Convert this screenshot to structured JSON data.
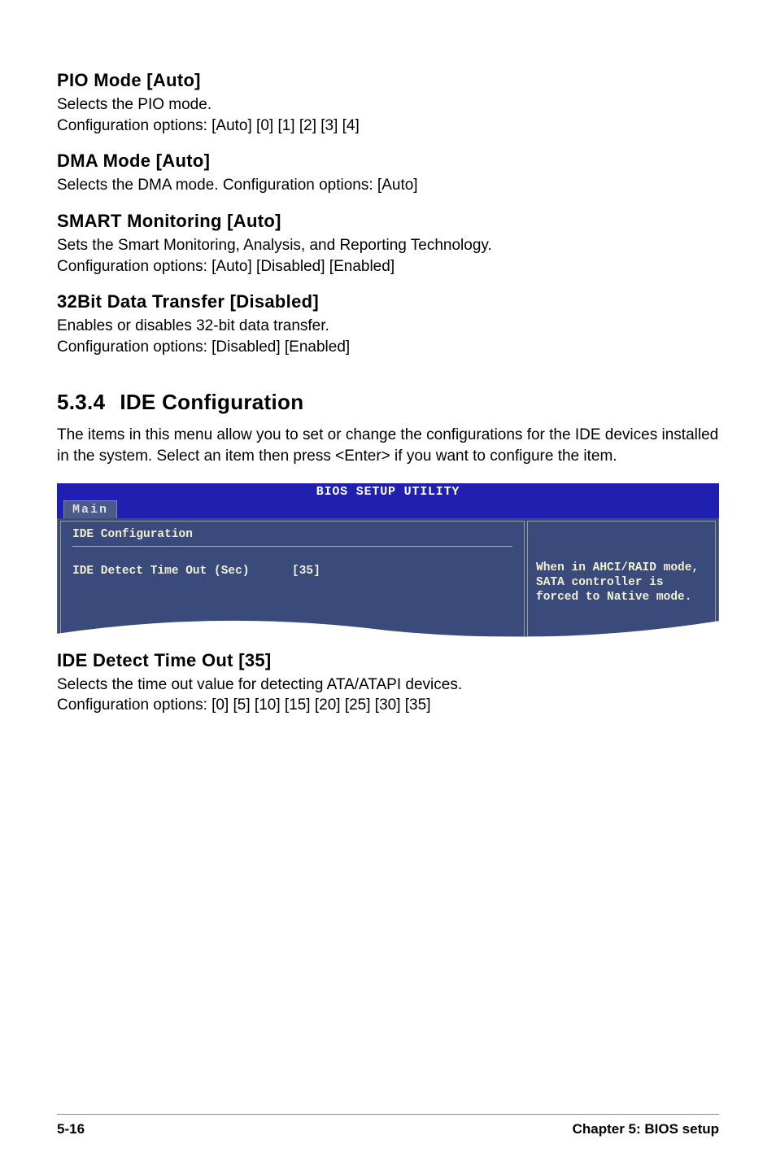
{
  "items": {
    "pio": {
      "heading": "PIO Mode [Auto]",
      "body": "Selects the PIO mode.\nConfiguration options: [Auto] [0] [1] [2] [3] [4]"
    },
    "dma": {
      "heading": "DMA Mode [Auto]",
      "body": "Selects the DMA mode. Configuration options: [Auto]"
    },
    "smart": {
      "heading": "SMART Monitoring [Auto]",
      "body": "Sets the Smart Monitoring, Analysis, and Reporting Technology.\nConfiguration options: [Auto] [Disabled] [Enabled]"
    },
    "xfer": {
      "heading": "32Bit Data Transfer [Disabled]",
      "body": "Enables or disables 32-bit data transfer.\nConfiguration options: [Disabled] [Enabled]"
    },
    "ide_detect": {
      "heading": "IDE Detect Time Out [35]",
      "body": "Selects the time out value for detecting ATA/ATAPI devices.\nConfiguration options: [0] [5] [10] [15] [20] [25] [30] [35]"
    }
  },
  "section": {
    "number": "5.3.4",
    "title": "IDE Configuration",
    "intro": "The items in this menu allow you to set or change the configurations for the IDE devices installed in the system. Select an item then press <Enter> if you want to configure the item."
  },
  "bios": {
    "title": "BIOS SETUP UTILITY",
    "tab": "Main",
    "panel_title": "IDE Configuration",
    "setting_label": "IDE Detect Time Out (Sec)",
    "setting_value": "[35]",
    "help_text": "When in AHCI/RAID mode, SATA controller is forced to Native mode."
  },
  "footer": {
    "page": "5-16",
    "chapter": "Chapter 5: BIOS setup"
  }
}
